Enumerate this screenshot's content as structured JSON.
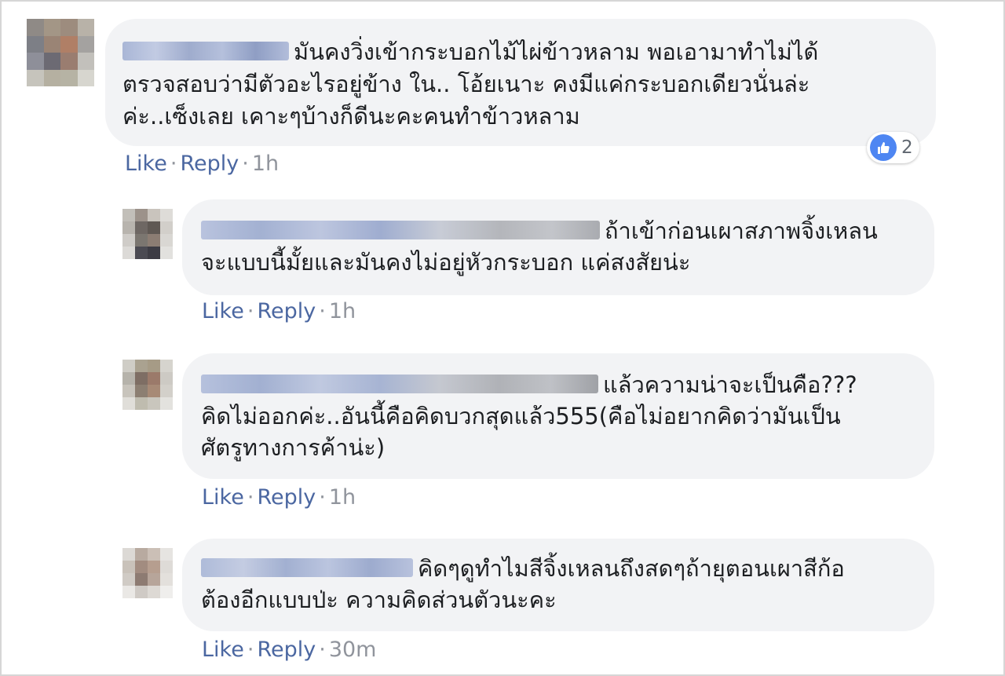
{
  "colors": {
    "bubble_bg": "#f2f3f5",
    "link": "#4b67a1",
    "meta": "#90949c",
    "text": "#1c1e21",
    "like_blue": "#4e86f2"
  },
  "comments": [
    {
      "lines": [
        "มันคงวิ่งเข้ากระบอกไม้ไผ่ข้าวหลาม พอเอามาทำไม่ได้",
        "ตรวจสอบว่ามีตัวอะไรอยู่ข้าง ใน.. โอ้ยเนาะ คงมีแค่กระบอกเดียวนั่นล่ะ",
        "ค่ะ..เซ็งเลย เคาะๆบ้างก็ดีนะคะคนทำข้าวหลาม"
      ],
      "like_label": "Like",
      "reply_label": "Reply",
      "time": "1h",
      "reaction": {
        "icon": "thumbs-up-icon",
        "count": "2"
      }
    },
    {
      "lines": [
        "ถ้าเข้าก่อนเผาสภาพจิ้งเหลน",
        "จะแบบนี้มั้ยและมันคงไม่อยู่หัวกระบอก แค่สงสัยน่ะ"
      ],
      "like_label": "Like",
      "reply_label": "Reply",
      "time": "1h"
    },
    {
      "lines": [
        "แล้วความน่าจะเป็นคือ???",
        "คิดไม่ออกค่ะ..อันนี้คือคิดบวกสุดแล้ว555(คือไม่อยากคิดว่ามันเป็น",
        "ศัตรูทางการค้าน่ะ)"
      ],
      "like_label": "Like",
      "reply_label": "Reply",
      "time": "1h"
    },
    {
      "lines": [
        "คิดๆดูทำไมสีจิ้งเหลนถึงสดๆถ้ายุตอนเผาสีก้อ",
        "ต้องอีกแบบป่ะ ความคิดส่วนตัวนะคะ"
      ],
      "like_label": "Like",
      "reply_label": "Reply",
      "time": "30m"
    }
  ]
}
